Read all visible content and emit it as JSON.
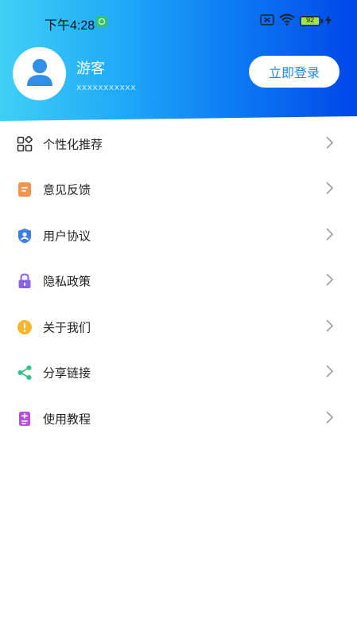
{
  "status_bar": {
    "time": "下午4:28",
    "battery": "92"
  },
  "profile": {
    "name": "游客",
    "account_id": "xxxxxxxxxxx",
    "login_label": "立即登录"
  },
  "colors": {
    "header_gradient_start": "#3fd0f5",
    "header_gradient_end": "#0046e8",
    "login_text": "#1e88e5"
  },
  "menu": {
    "items": [
      {
        "label": "个性化推荐",
        "icon": "grid-icon"
      },
      {
        "label": "意见反馈",
        "icon": "feedback-icon"
      },
      {
        "label": "用户协议",
        "icon": "user-shield-icon"
      },
      {
        "label": "隐私政策",
        "icon": "lock-icon"
      },
      {
        "label": "关于我们",
        "icon": "info-icon"
      },
      {
        "label": "分享链接",
        "icon": "share-icon"
      },
      {
        "label": "使用教程",
        "icon": "tutorial-icon"
      }
    ]
  }
}
